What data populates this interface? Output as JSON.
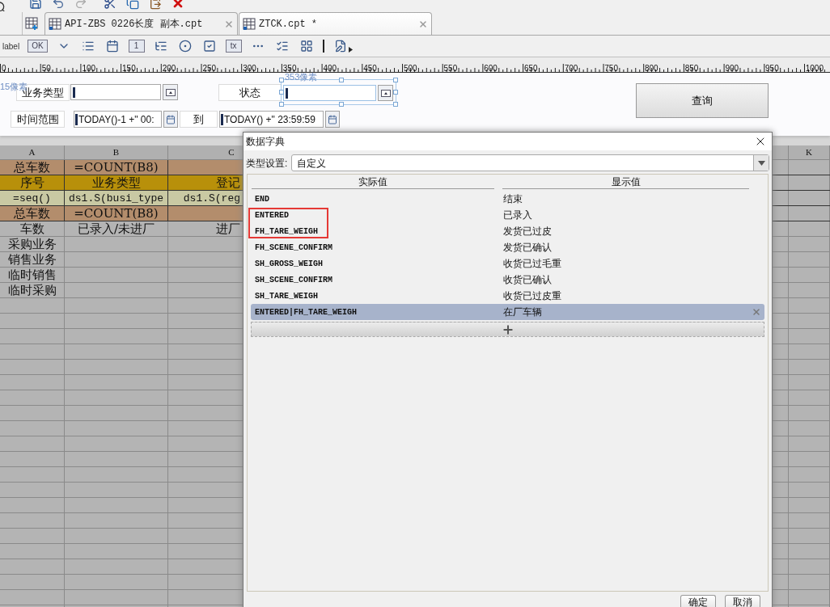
{
  "tabs": [
    {
      "label": "API-ZBS 0226长度 副本.cpt",
      "selected": false
    },
    {
      "label": "ZTCK.cpt *",
      "selected": true
    }
  ],
  "widget_toolbar": [
    {
      "kind": "text",
      "text": "label"
    },
    {
      "kind": "boxed",
      "text": "OK"
    },
    {
      "kind": "combo"
    },
    {
      "kind": "list"
    },
    {
      "kind": "date"
    },
    {
      "kind": "boxed",
      "text": "1"
    },
    {
      "kind": "tree"
    },
    {
      "kind": "radio"
    },
    {
      "kind": "check"
    },
    {
      "kind": "boxed",
      "text": "tx"
    },
    {
      "kind": "more"
    },
    {
      "kind": "checkgroup"
    },
    {
      "kind": "frame"
    },
    {
      "kind": "separator"
    },
    {
      "kind": "edit"
    }
  ],
  "ruler": {
    "labels": [
      "0",
      "50",
      "100",
      "150",
      "200",
      "250",
      "300",
      "350",
      "400",
      "450",
      "500",
      "550",
      "600",
      "650",
      "700",
      "750",
      "800",
      "850",
      "900",
      "950",
      "1000"
    ]
  },
  "parameters": {
    "hints": [
      "15像素",
      "353像素"
    ],
    "widgets": [
      {
        "kind": "label",
        "text": "业务类型"
      },
      {
        "kind": "combo",
        "selected": false
      },
      {
        "kind": "label",
        "text": "状态"
      },
      {
        "kind": "combo",
        "selected": true
      },
      {
        "kind": "label",
        "text": "时间范围"
      },
      {
        "kind": "date",
        "value": "TODAY()-1 +\" 00:"
      },
      {
        "kind": "label",
        "text": "到"
      },
      {
        "kind": "date",
        "value": "TODAY() +\" 23:59:59"
      }
    ],
    "query_button": "查询"
  },
  "sheet": {
    "columns": [
      {
        "header": "A"
      },
      {
        "header": "B"
      },
      {
        "header": "C"
      },
      {
        "header": "K"
      }
    ],
    "rows": [
      {
        "kind": "total",
        "cells": [
          "总车数",
          "=COUNT(B8)"
        ]
      },
      {
        "kind": "header",
        "cells": [
          "序号",
          "业务类型",
          "登记"
        ]
      },
      {
        "kind": "formula",
        "cells": [
          "=seq()",
          "ds1.S(busi_type",
          "ds1.S(reg"
        ]
      },
      {
        "kind": "total",
        "cells": [
          "总车数",
          "=COUNT(B8)"
        ]
      },
      {
        "kind": "plain",
        "cells": [
          "车数",
          "已录入/未进厂",
          "进厂"
        ]
      },
      {
        "kind": "plain",
        "cells": [
          "采购业务"
        ]
      },
      {
        "kind": "plain",
        "cells": [
          "销售业务"
        ]
      },
      {
        "kind": "plain",
        "cells": [
          "临时销售"
        ]
      },
      {
        "kind": "plain",
        "cells": [
          "临时采购"
        ]
      }
    ]
  },
  "dialog": {
    "title": "数据字典",
    "type_label": "类型设置:",
    "type_value": "自定义",
    "columns": [
      "实际值",
      "显示值"
    ],
    "rows": [
      {
        "actual": "END",
        "display": "结束",
        "selected": false
      },
      {
        "actual": "ENTERED",
        "display": "已录入",
        "selected": false
      },
      {
        "actual": "FH_TARE_WEIGH",
        "display": "发货已过皮",
        "selected": false
      },
      {
        "actual": "FH_SCENE_CONFIRM",
        "display": "发货已确认",
        "selected": false
      },
      {
        "actual": "SH_GROSS_WEIGH",
        "display": "收货已过毛重",
        "selected": false
      },
      {
        "actual": "SH_SCENE_CONFIRM",
        "display": "收货已确认",
        "selected": false
      },
      {
        "actual": "SH_TARE_WEIGH",
        "display": "收货已过皮重",
        "selected": false
      },
      {
        "actual": "ENTERED|FH_TARE_WEIGH",
        "display": "在厂车辆",
        "selected": true
      }
    ],
    "buttons": [
      "确定",
      "取消"
    ]
  }
}
